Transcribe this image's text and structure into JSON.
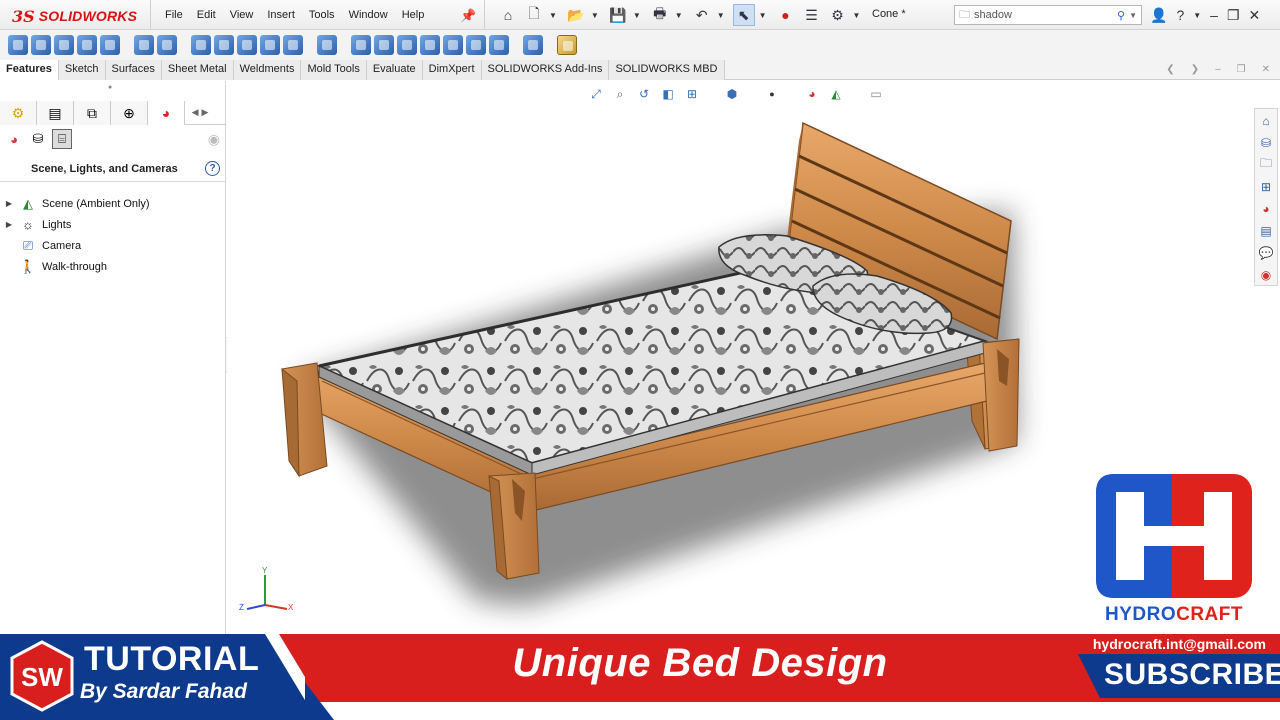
{
  "app": {
    "name": "SOLIDWORKS",
    "logo_prefix": "3S",
    "document_title": "Cone *"
  },
  "menu": [
    "File",
    "Edit",
    "View",
    "Insert",
    "Tools",
    "Window",
    "Help"
  ],
  "search": {
    "value": "shadow"
  },
  "tabs": [
    {
      "label": "Features",
      "active": true
    },
    {
      "label": "Sketch",
      "active": false
    },
    {
      "label": "Surfaces",
      "active": false
    },
    {
      "label": "Sheet Metal",
      "active": false
    },
    {
      "label": "Weldments",
      "active": false
    },
    {
      "label": "Mold Tools",
      "active": false
    },
    {
      "label": "Evaluate",
      "active": false
    },
    {
      "label": "DimXpert",
      "active": false
    },
    {
      "label": "SOLIDWORKS Add-Ins",
      "active": false
    },
    {
      "label": "SOLIDWORKS MBD",
      "active": false
    }
  ],
  "panel": {
    "title": "Scene, Lights, and Cameras",
    "help": "?",
    "tree": [
      {
        "label": "Scene (Ambient Only)",
        "expandable": true,
        "icon": "scene-icon"
      },
      {
        "label": "Lights",
        "expandable": true,
        "icon": "lights-icon"
      },
      {
        "label": "Camera",
        "expandable": false,
        "icon": "camera-icon"
      },
      {
        "label": "Walk-through",
        "expandable": false,
        "icon": "walkthrough-icon"
      }
    ]
  },
  "triad": {
    "x": "X",
    "y": "Y",
    "z": "Z"
  },
  "watermark": {
    "brand_a": "HYDRO",
    "brand_b": "CRAFT",
    "colors": {
      "red": "#e0221c",
      "blue": "#1f57c9"
    }
  },
  "banner": {
    "tutorial": "TUTORIAL",
    "author": "By Sardar Fahad",
    "title": "Unique Bed Design",
    "email": "hydrocraft.int@gmail.com",
    "subscribe": "SUBSCRIBE",
    "badge": "SW",
    "colors": {
      "red": "#d91e1e",
      "blue": "#0d3a8c"
    }
  }
}
